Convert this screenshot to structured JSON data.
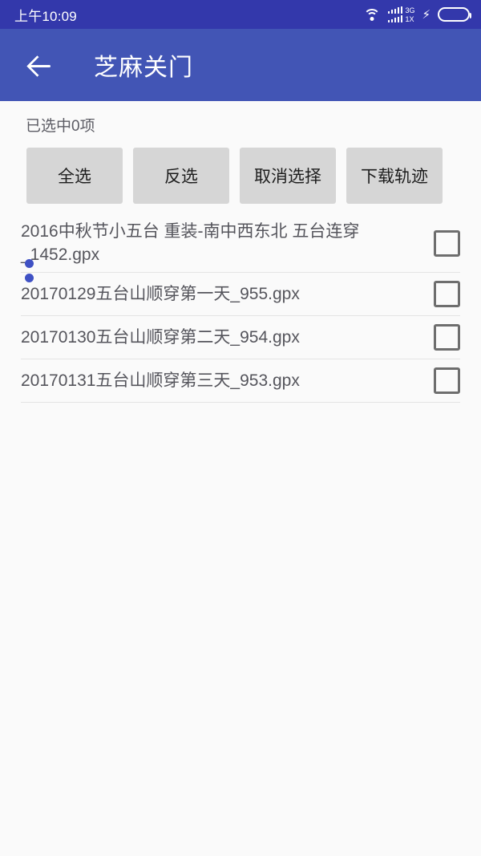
{
  "status_bar": {
    "time": "上午10:09",
    "wifi_icon": "wifi-icon",
    "signal_icon": "signal-bars-icon",
    "network_primary": "3G",
    "network_secondary": "1X",
    "charging_icon": "⚡",
    "battery_icon": "battery-icon",
    "battery_color": "#3ac03a",
    "bar_color": "#3338ab"
  },
  "app_bar": {
    "back_icon": "back-arrow-icon",
    "title": "芝麻关门",
    "color": "#4255b5"
  },
  "selection": {
    "status_text": "已选中0项"
  },
  "actions": [
    {
      "label": "全选",
      "name": "select-all-button"
    },
    {
      "label": "反选",
      "name": "invert-selection-button"
    },
    {
      "label": "取消选择",
      "name": "cancel-selection-button"
    },
    {
      "label": "下载轨迹",
      "name": "download-tracks-button"
    }
  ],
  "files": [
    {
      "name": "2016中秋节小五台 重装-南中西东北 五台连穿_1452.gpx",
      "checked": false
    },
    {
      "name": "20170129五台山顺穿第一天_955.gpx",
      "checked": false
    },
    {
      "name": "20170130五台山顺穿第二天_954.gpx",
      "checked": false
    },
    {
      "name": "20170131五台山顺穿第三天_953.gpx",
      "checked": false
    }
  ],
  "theme": {
    "background": "#fafafa",
    "button_fill": "#d6d6d6",
    "text_color": "#55555c",
    "accent_dot": "#3f51c4"
  }
}
